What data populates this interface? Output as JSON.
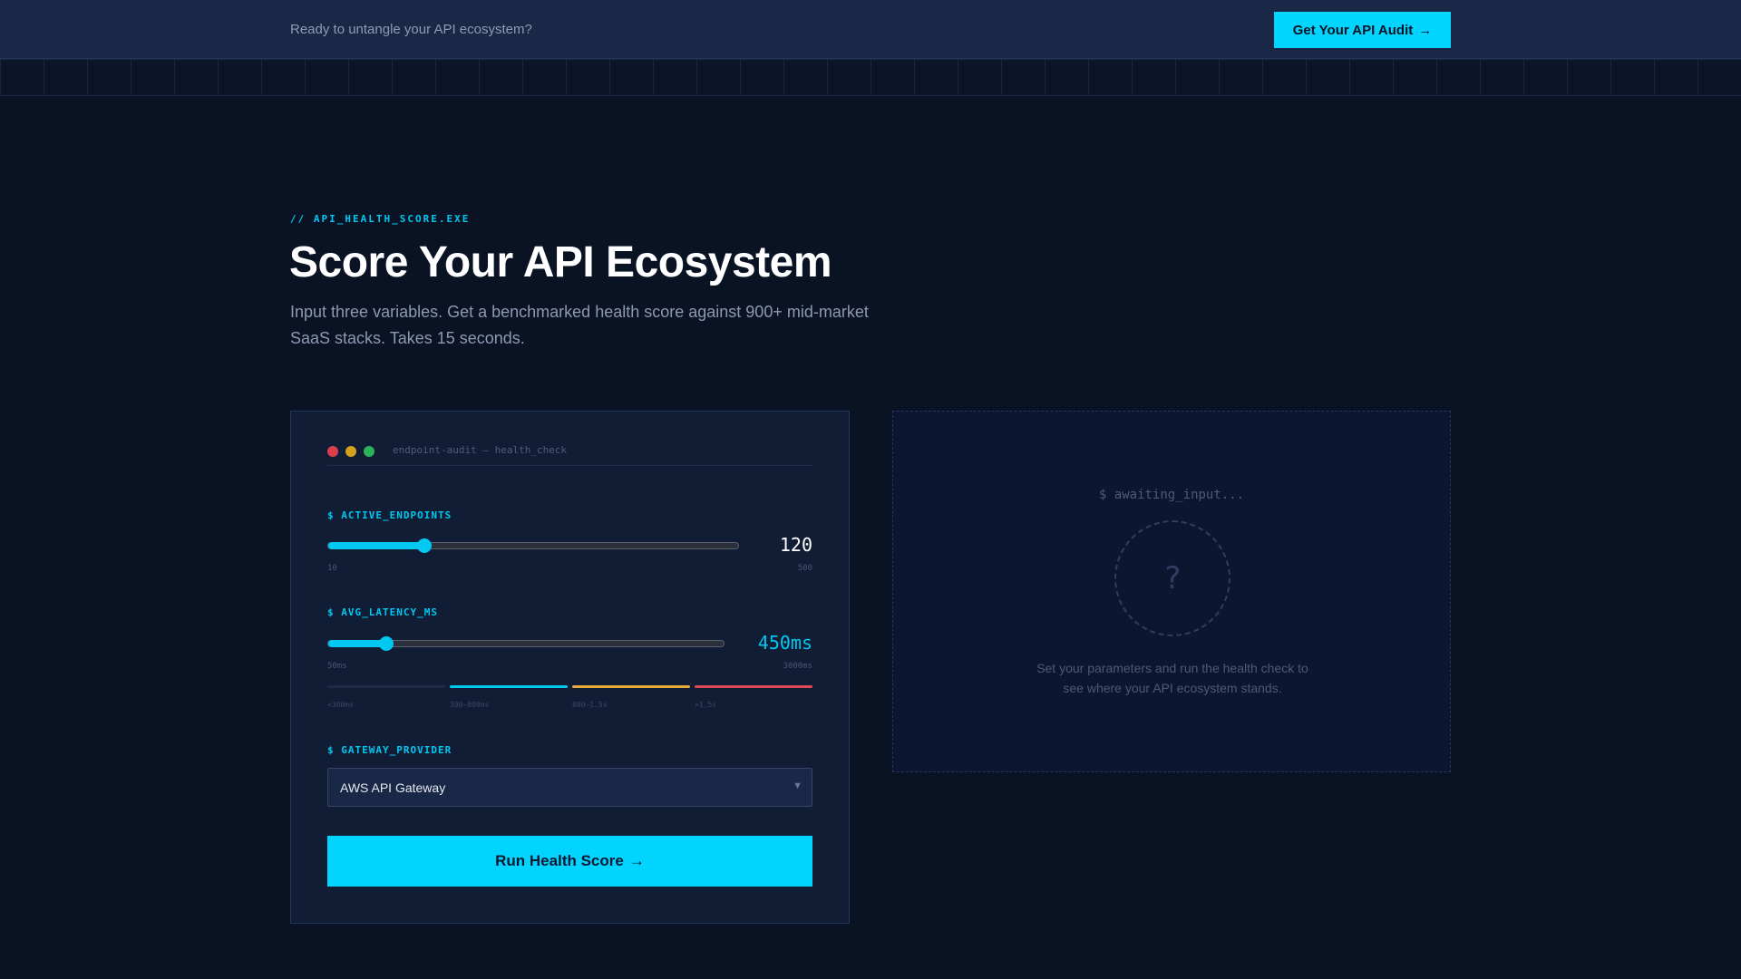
{
  "topbar": {
    "text": "Ready to untangle your API ecosystem?",
    "cta_label": "Get Your API Audit",
    "cta_arrow": "→"
  },
  "hero": {
    "eyebrow": "// API_HEALTH_SCORE.EXE",
    "title": "Score Your API Ecosystem",
    "subtitle": "Input three variables. Get a benchmarked health score against 900+ mid-market SaaS stacks. Takes 15 seconds."
  },
  "form": {
    "window_title": "endpoint-audit — health_check",
    "endpoints": {
      "label": "$ ACTIVE_ENDPOINTS",
      "value": "120",
      "min_label": "10",
      "max_label": "500",
      "fraction": 0.2347
    },
    "latency": {
      "label": "$ AVG_LATENCY_MS",
      "value": "450ms",
      "min_label": "50ms",
      "max_label": "3000ms",
      "fraction": 0.1458,
      "bands": [
        {
          "label": "<300ms",
          "color": "#1f2a44"
        },
        {
          "label": "300–800ms",
          "color": "#00c8f0"
        },
        {
          "label": "800–1.5s",
          "color": "#e6a93a"
        },
        {
          "label": ">1.5s",
          "color": "#e0485a"
        }
      ]
    },
    "gateway": {
      "label": "$ GATEWAY_PROVIDER",
      "selected": "AWS API Gateway",
      "arrow": "▼"
    },
    "submit_label": "Run Health Score",
    "submit_arrow": "→"
  },
  "result": {
    "status": "$ awaiting_input...",
    "placeholder_glyph": "?",
    "message": "Set your parameters and run the health check to see where your API ecosystem stands."
  },
  "colors": {
    "accent": "#00d4ff",
    "background": "#0a1324",
    "card": "#111c35"
  }
}
